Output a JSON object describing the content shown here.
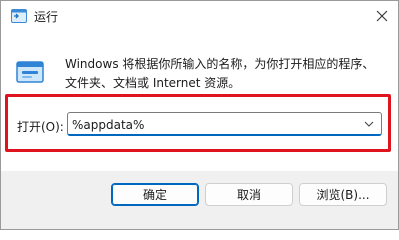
{
  "window": {
    "title": "运行",
    "close_icon": "close-icon",
    "app_icon": "run-app-icon"
  },
  "description": "Windows 将根据你所输入的名称，为你打开相应的程序、\n文件夹、文档或 Internet 资源。",
  "open_field": {
    "label": "打开(O):",
    "value": "%appdata%",
    "dropdown_icon": "chevron-down-icon"
  },
  "highlight_color": "#e0141e",
  "accent_color": "#0067c0",
  "buttons": {
    "ok": "确定",
    "cancel": "取消",
    "browse": "浏览(B)..."
  }
}
